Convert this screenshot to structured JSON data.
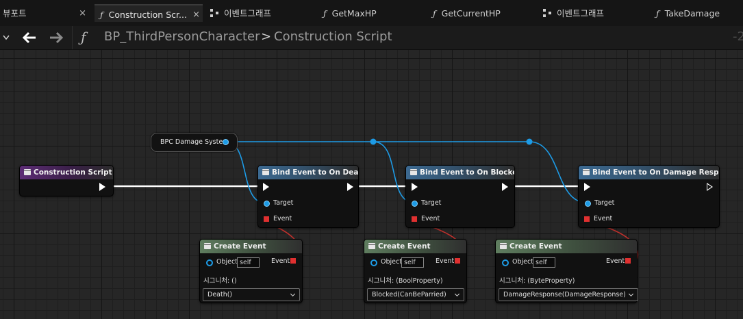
{
  "tabs": [
    {
      "label": "뷰포트",
      "icon": "none",
      "closable": true
    },
    {
      "label": "Construction Scr...",
      "icon": "function-icon",
      "closable": true,
      "active": true
    },
    {
      "label": "이벤트그래프",
      "icon": "event-graph-icon"
    },
    {
      "label": "GetMaxHP",
      "icon": "function-icon"
    },
    {
      "label": "GetCurrentHP",
      "icon": "function-icon"
    },
    {
      "label": "이벤트그래프",
      "icon": "event-graph-icon"
    },
    {
      "label": "TakeDamage",
      "icon": "function-icon"
    }
  ],
  "tab_close_glyph": "×",
  "breadcrumb": {
    "blueprint": "BP_ThirdPersonCharacter",
    "separator": ">",
    "graph": "Construction Script",
    "zoom_partial": "-2"
  },
  "graph": {
    "variable_node": {
      "label": "BPC Damage System"
    },
    "construction_node": {
      "title": "Construction Script"
    },
    "bind_nodes": [
      {
        "title": "Bind Event to On Death",
        "target_label": "Target",
        "event_label": "Event"
      },
      {
        "title": "Bind Event to On Blocked",
        "target_label": "Target",
        "event_label": "Event"
      },
      {
        "title": "Bind Event to On Damage Response",
        "target_label": "Target",
        "event_label": "Event"
      }
    ],
    "create_event_nodes": [
      {
        "title": "Create Event",
        "object_label": "Object",
        "object_value": "self",
        "event_label": "Event",
        "signature": "시그니처: ()",
        "function": "Death()"
      },
      {
        "title": "Create Event",
        "object_label": "Object",
        "object_value": "self",
        "event_label": "Event",
        "signature": "시그니처: (BoolProperty)",
        "function": "Blocked(CanBeParried)"
      },
      {
        "title": "Create Event",
        "object_label": "Object",
        "object_value": "self",
        "event_label": "Event",
        "signature": "시그니처: (ByteProperty)",
        "function": "DamageResponse(DamageResponse)"
      }
    ]
  },
  "colors": {
    "exec_wire": "#ffffff",
    "object_wire": "#1d9be6",
    "delegate_wire": "#c0302c",
    "construction_header": "#5d2d76",
    "bind_header": "#3c6a92",
    "create_event_header": "#5f7d5f"
  }
}
